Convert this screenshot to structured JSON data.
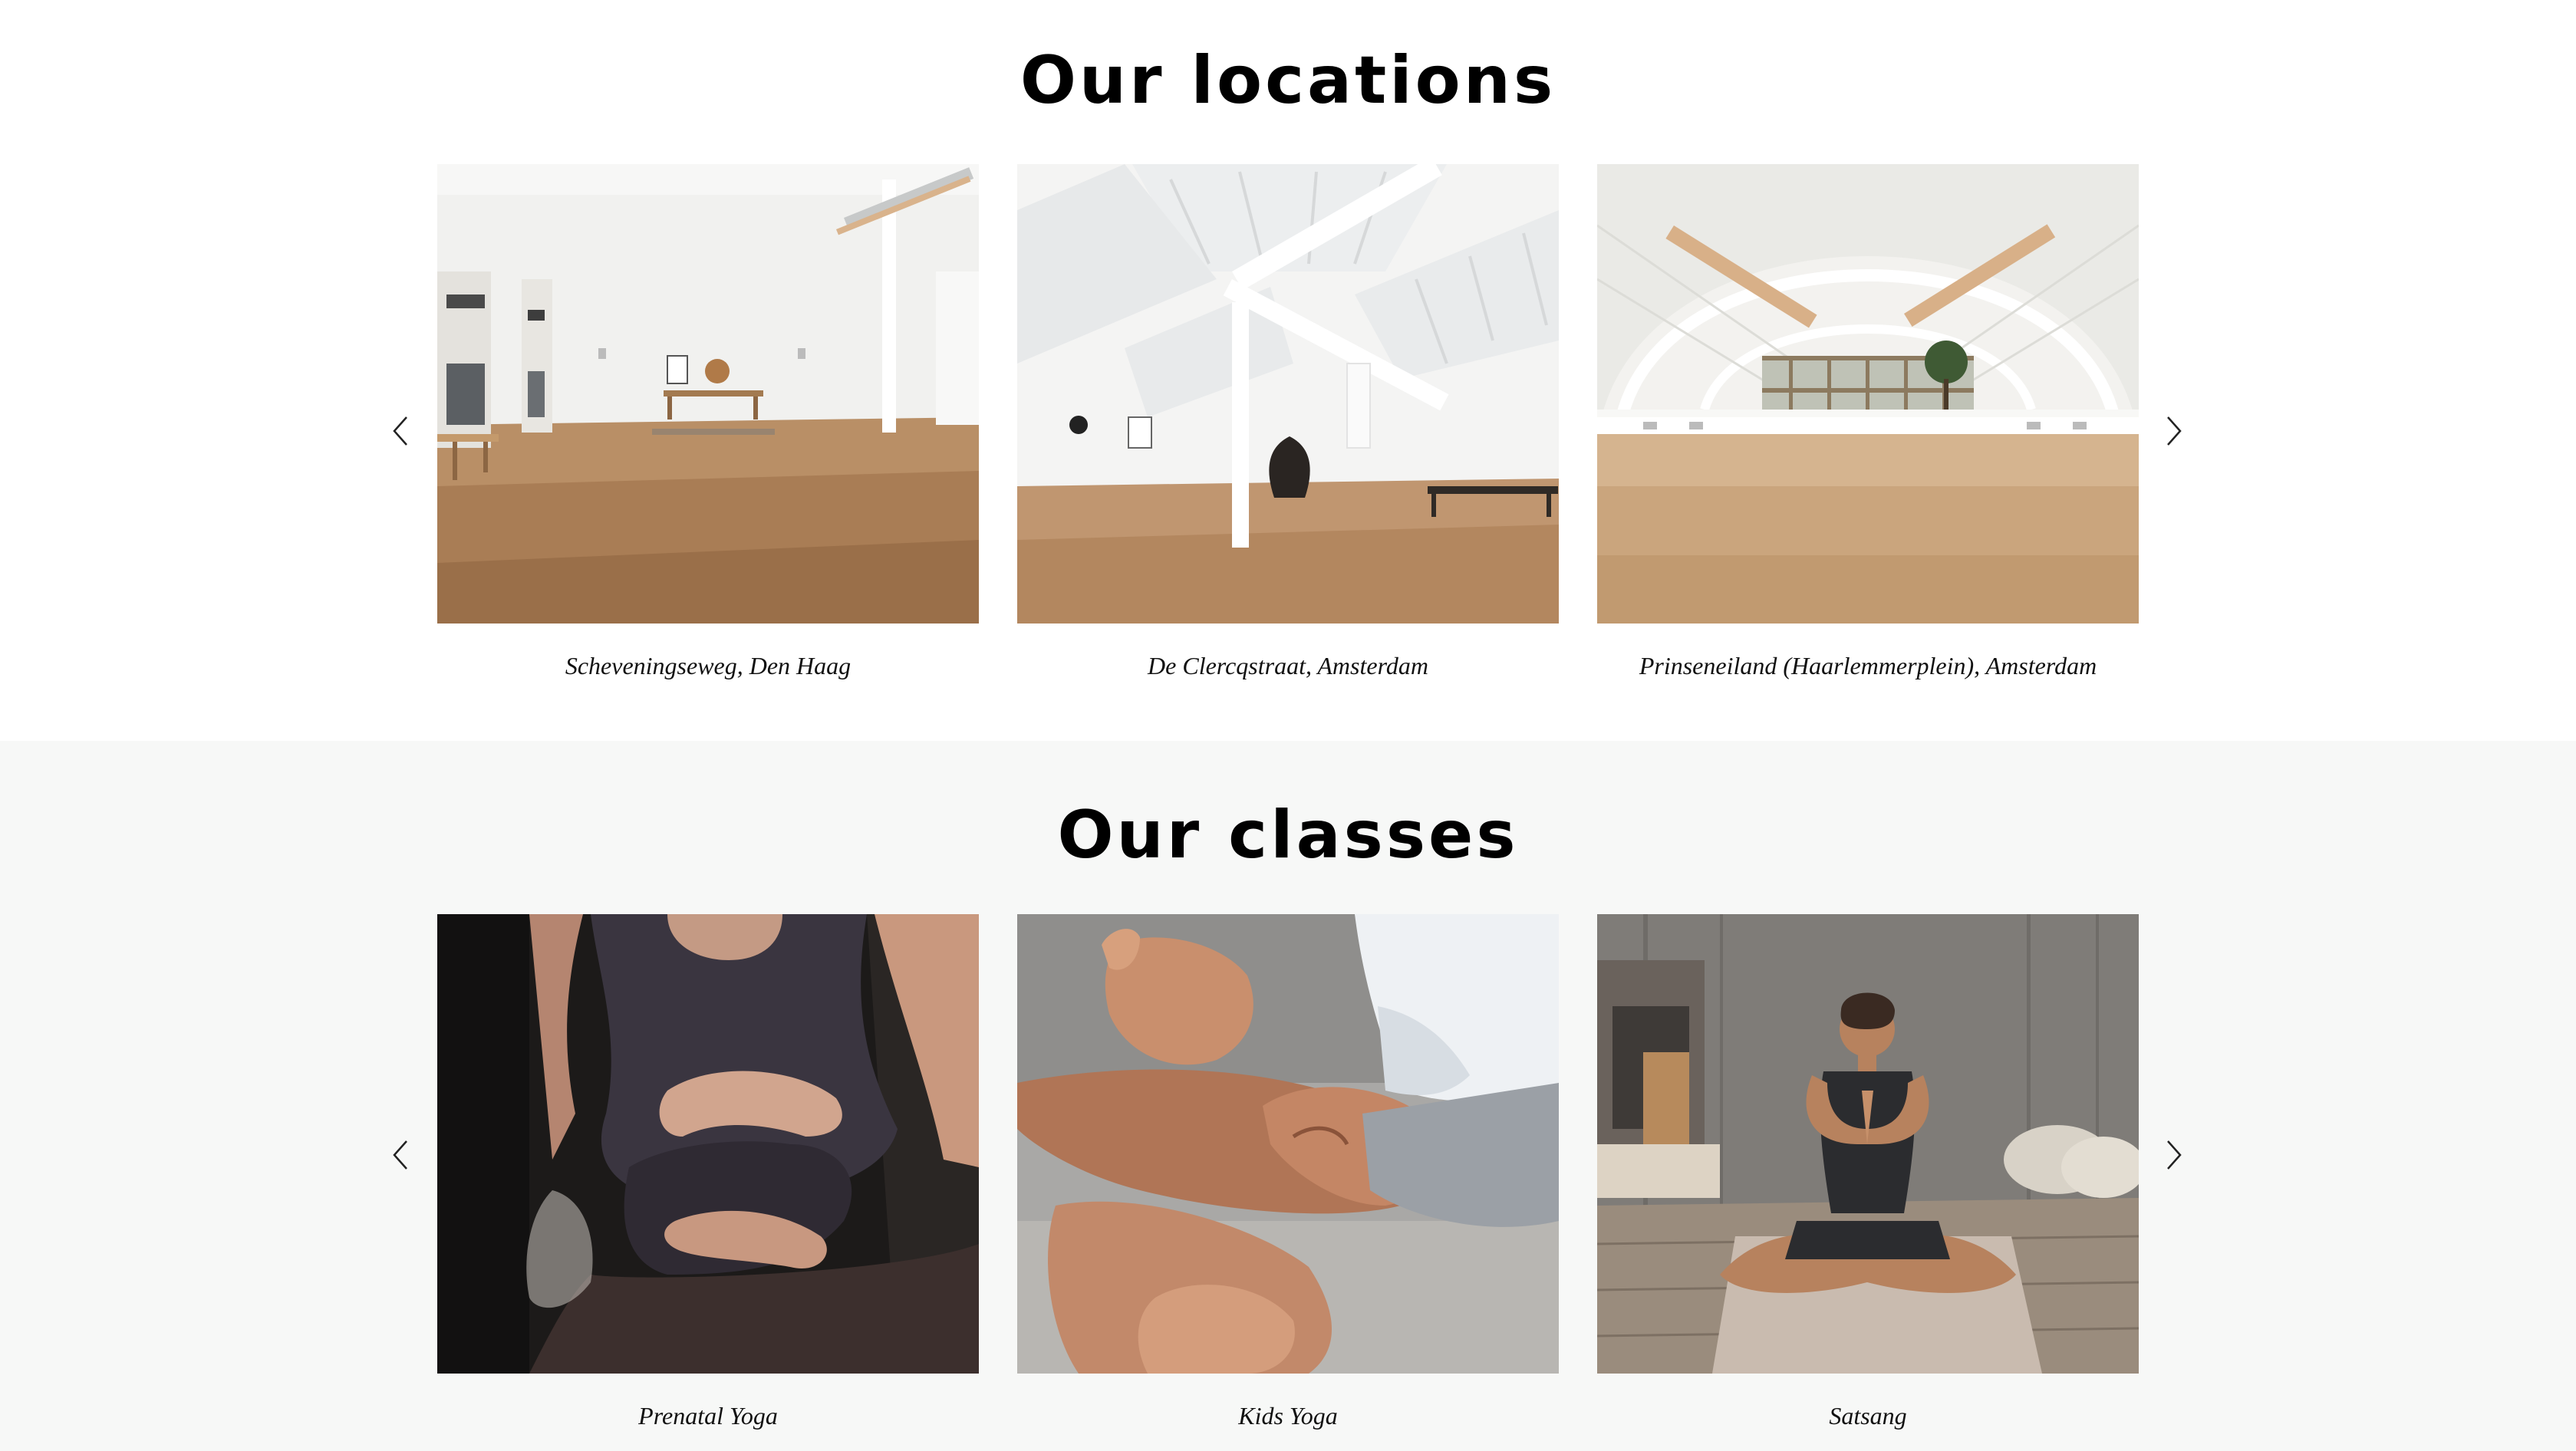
{
  "locations": {
    "title": "Our locations",
    "prev_icon": "chevron-left-icon",
    "next_icon": "chevron-right-icon",
    "items": [
      {
        "caption": "Scheveningseweg, Den Haag",
        "image": "studio-room-photo"
      },
      {
        "caption": "De Clercqstraat, Amsterdam",
        "image": "studio-skylight-photo"
      },
      {
        "caption": "Prinseneiland (Haarlemmerplein), Amsterdam",
        "image": "studio-arched-roof-photo"
      }
    ]
  },
  "classes": {
    "title": "Our classes",
    "prev_icon": "chevron-left-icon",
    "next_icon": "chevron-right-icon",
    "items": [
      {
        "caption": "Prenatal Yoga",
        "image": "prenatal-yoga-photo"
      },
      {
        "caption": "Kids Yoga",
        "image": "kids-yoga-photo"
      },
      {
        "caption": "Satsang",
        "image": "satsang-meditation-photo"
      }
    ]
  },
  "colors": {
    "page_background": "#ffffff",
    "classes_background": "#f7f8f7",
    "heading": "#000000",
    "caption": "#111111"
  }
}
